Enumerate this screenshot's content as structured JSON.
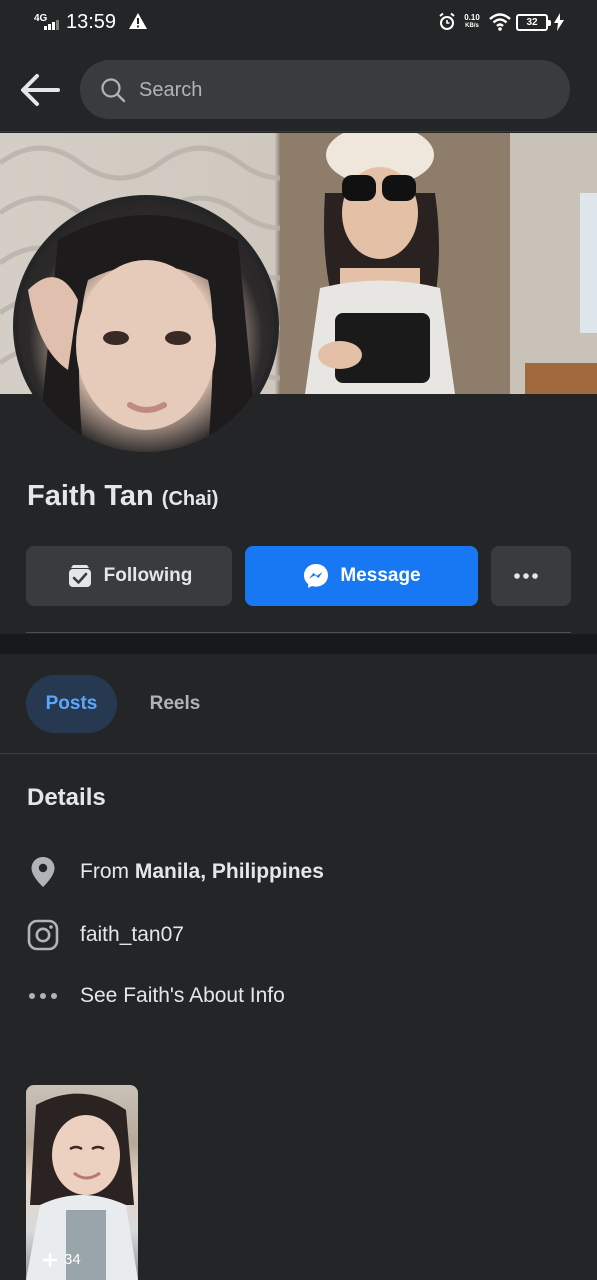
{
  "status_bar": {
    "network": "4G",
    "time": "13:59",
    "speed_value": "0.10",
    "speed_unit": "KB/s",
    "battery": "32"
  },
  "header": {
    "search_placeholder": "Search"
  },
  "profile": {
    "name": "Faith Tan",
    "nickname": "(Chai)"
  },
  "actions": {
    "following_label": "Following",
    "message_label": "Message"
  },
  "tabs": [
    {
      "label": "Posts",
      "active": true
    },
    {
      "label": "Reels",
      "active": false
    }
  ],
  "details": {
    "title": "Details",
    "from_prefix": "From",
    "location": "Manila, Philippines",
    "instagram": "faith_tan07",
    "about_link": "See Faith's About Info"
  },
  "photos": {
    "more_count": "34"
  },
  "colors": {
    "background": "#242526",
    "accent": "#1877f2",
    "active_tab_bg": "#263951",
    "active_tab_text": "#5aa7ff"
  }
}
